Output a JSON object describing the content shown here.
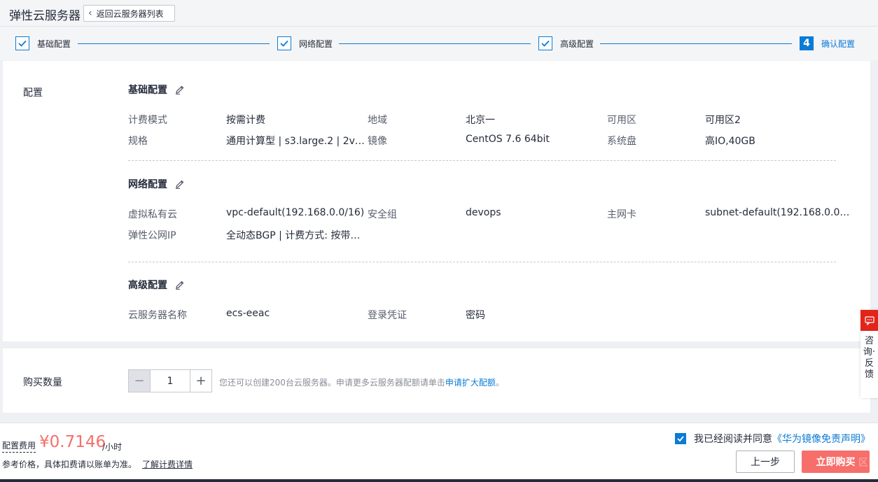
{
  "header": {
    "title": "弹性云服务器",
    "back_label": "返回云服务器列表"
  },
  "steps": [
    {
      "label": "基础配置",
      "state": "done"
    },
    {
      "label": "网络配置",
      "state": "done"
    },
    {
      "label": "高级配置",
      "state": "done"
    },
    {
      "label": "确认配置",
      "state": "active",
      "number": "4"
    }
  ],
  "config": {
    "section_label": "配置",
    "basic": {
      "title": "基础配置",
      "rows": [
        [
          {
            "k": "计费模式",
            "v": "按需计费"
          },
          {
            "k": "地域",
            "v": "北京一"
          },
          {
            "k": "可用区",
            "v": "可用区2"
          }
        ],
        [
          {
            "k": "规格",
            "v": "通用计算型 | s3.large.2 | 2v…"
          },
          {
            "k": "镜像",
            "v": "CentOS 7.6 64bit"
          },
          {
            "k": "系统盘",
            "v": "高IO,40GB"
          }
        ]
      ]
    },
    "network": {
      "title": "网络配置",
      "rows": [
        [
          {
            "k": "虚拟私有云",
            "v": "vpc-default(192.168.0.0/16)"
          },
          {
            "k": "安全组",
            "v": "devops"
          },
          {
            "k": "主网卡",
            "v": "subnet-default(192.168.0.0…"
          }
        ],
        [
          {
            "k": "弹性公网IP",
            "v": "全动态BGP | 计费方式: 按带…"
          }
        ]
      ]
    },
    "advanced": {
      "title": "高级配置",
      "rows": [
        [
          {
            "k": "云服务器名称",
            "v": "ecs-eeac"
          },
          {
            "k": "登录凭证",
            "v": "密码"
          }
        ]
      ]
    }
  },
  "quantity": {
    "label": "购买数量",
    "value": "1",
    "minus": "−",
    "plus": "+",
    "hint": "您还可以创建200台云服务器。申请更多云服务器配额请单击",
    "hint_link": "申请扩大配额",
    "hint_end": "。"
  },
  "footer": {
    "fee_label": "配置费用",
    "price": "¥0.7146",
    "unit": "/小时",
    "note": "参考价格，具体扣费请以账单为准。",
    "note_link": "了解计费详情",
    "agree_text": "我已经阅读并同意",
    "agree_link": "《华为镜像免责声明》",
    "agree_checked": true,
    "prev_label": "上一步",
    "buy_label": "立即购买",
    "watermark": "区"
  },
  "float": {
    "icon": "chat-icon",
    "text": "咨询·反馈"
  },
  "colors": {
    "accent": "#0b7bd5",
    "price": "#f66f6a",
    "float_icon_bg": "#e1251b"
  }
}
